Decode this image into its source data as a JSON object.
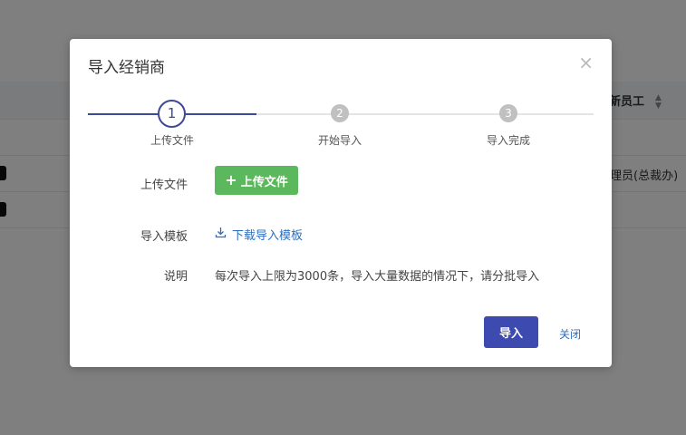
{
  "background": {
    "column_header": "新员工",
    "cell_value": "理员(总裁办)"
  },
  "dialog": {
    "title": "导入经销商",
    "close_glyph": "×"
  },
  "steps": [
    {
      "number": "1",
      "label": "上传文件",
      "state": "active"
    },
    {
      "number": "2",
      "label": "开始导入",
      "state": "pending"
    },
    {
      "number": "3",
      "label": "导入完成",
      "state": "pending"
    }
  ],
  "form": {
    "upload_label": "上传文件",
    "upload_button": "上传文件",
    "template_label": "导入模板",
    "template_link": "下载导入模板",
    "desc_label": "说明",
    "desc_text": "每次导入上限为3000条，导入大量数据的情况下，请分批导入"
  },
  "footer": {
    "import_button": "导入",
    "close_button": "关闭"
  },
  "colors": {
    "accent": "#3d4a9a",
    "primary_button": "#3d4ab0",
    "upload_button": "#5cb85c",
    "link": "#2d6fbf",
    "pending_step": "#c0c0c0"
  },
  "icons": {
    "close": "close-icon",
    "plus": "plus-icon",
    "download": "download-icon",
    "sort": "sort-icon"
  }
}
